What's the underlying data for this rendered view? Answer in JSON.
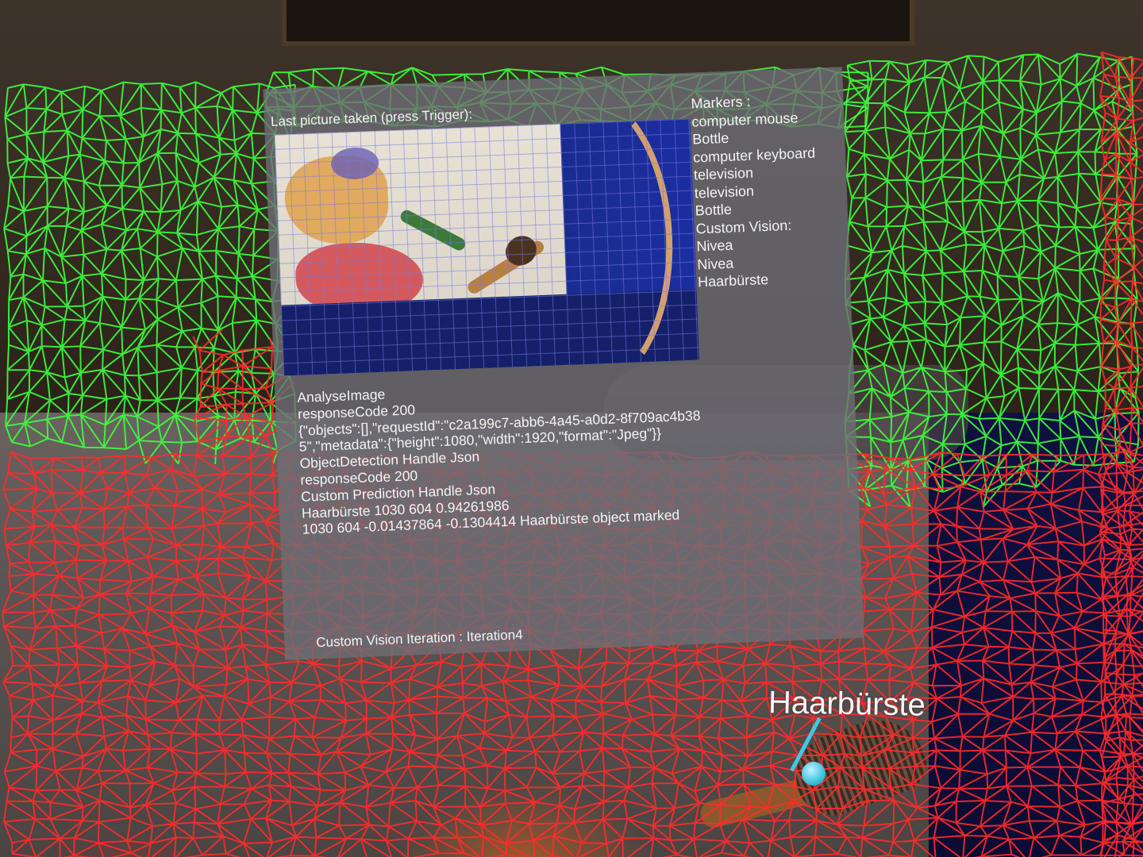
{
  "panel": {
    "caption": "Last picture taken (press Trigger):",
    "markers_title": "Markers :",
    "markers": [
      "computer mouse",
      "Bottle",
      "computer keyboard",
      "television",
      "television",
      "Bottle",
      "Custom Vision:",
      "Nivea",
      "Nivea",
      "Haarbürste"
    ],
    "log": [
      "AnalyseImage",
      "responseCode 200",
      "{\"objects\":[],\"requestId\":\"c2a199c7-abb6-4a45-a0d2-8f709ac4b385\",\"metadata\":{\"height\":1080,\"width\":1920,\"format\":\"Jpeg\"}}",
      "ObjectDetection Handle Json",
      "responseCode 200",
      "Custom Prediction Handle Json",
      "Haarbürste 1030 604 0.94261986",
      "1030 604 -0.01437864 -0.1304414 Haarbürste object marked"
    ],
    "iteration": "Custom Vision Iteration : Iteration4"
  },
  "ar_label": {
    "text": "Haarbürste",
    "color": "#40c8e0"
  },
  "colors": {
    "vertical_mesh": "#3dff3d",
    "horizontal_mesh": "#ff2a2a",
    "panel_bg": "rgba(110,110,118,0.80)"
  }
}
